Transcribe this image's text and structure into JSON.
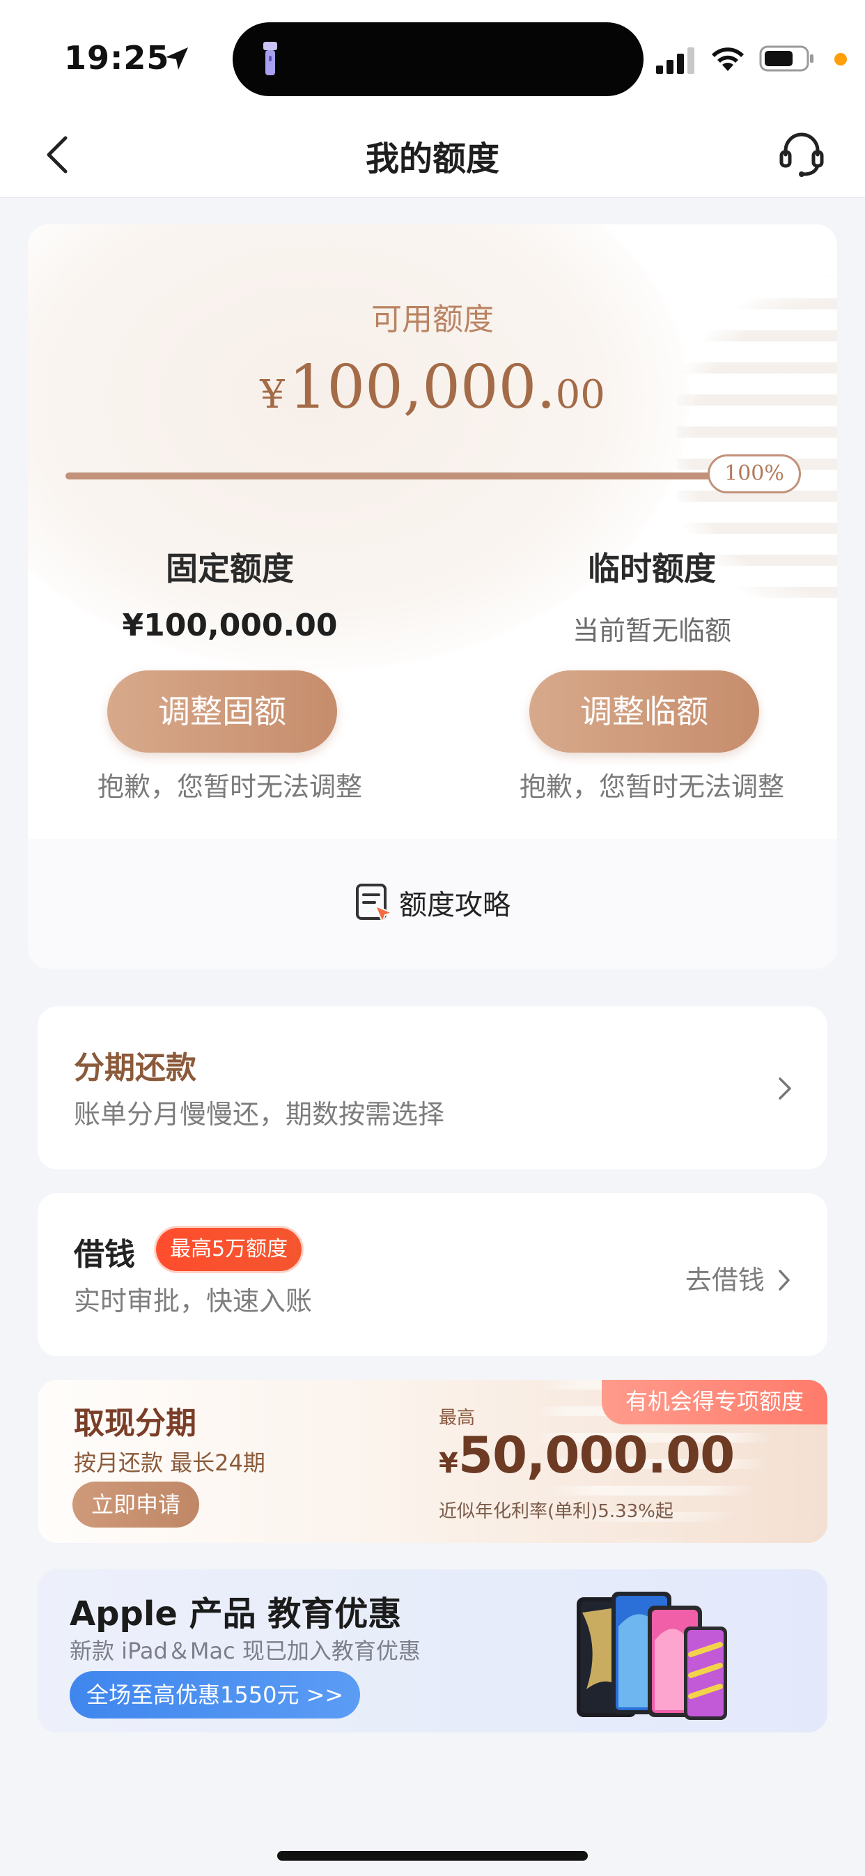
{
  "status_bar": {
    "time": "19:25"
  },
  "nav": {
    "title": "我的额度"
  },
  "quota": {
    "available_label": "可用额度",
    "currency": "¥",
    "available_int": "100,000.",
    "available_cents": "00",
    "progress_fraction": 1.0,
    "progress_text": "100%",
    "fixed": {
      "title": "固定额度",
      "value": "¥100,000.00",
      "button": "调整固额",
      "note": "抱歉，您暂时无法调整"
    },
    "temporary": {
      "title": "临时额度",
      "value": "当前暂无临额",
      "button": "调整临额",
      "note": "抱歉，您暂时无法调整"
    },
    "strategy": "额度攻略"
  },
  "installment": {
    "title": "分期还款",
    "subtitle": "账单分月慢慢还，期数按需选择"
  },
  "borrow": {
    "title": "借钱",
    "badge": "最高5万额度",
    "subtitle": "实时审批，快速入账",
    "action": "去借钱"
  },
  "cash_installment": {
    "tag": "有机会得专项额度",
    "title": "取现分期",
    "subtitle": "按月还款 最长24期",
    "button": "立即申请",
    "max_label": "最高",
    "currency": "¥",
    "amount": "50,000.00",
    "rate": "近似年化利率(单利)5.33%起"
  },
  "apple_banner": {
    "title": "Apple 产品 教育优惠",
    "subtitle": "新款 iPad＆Mac 现已加入教育优惠",
    "button": "全场至高优惠1550元 >>"
  },
  "colors": {
    "accent_brown": "#c2917a",
    "badge_red": "#ff4d2e",
    "apple_blue": "#3f86ee"
  }
}
